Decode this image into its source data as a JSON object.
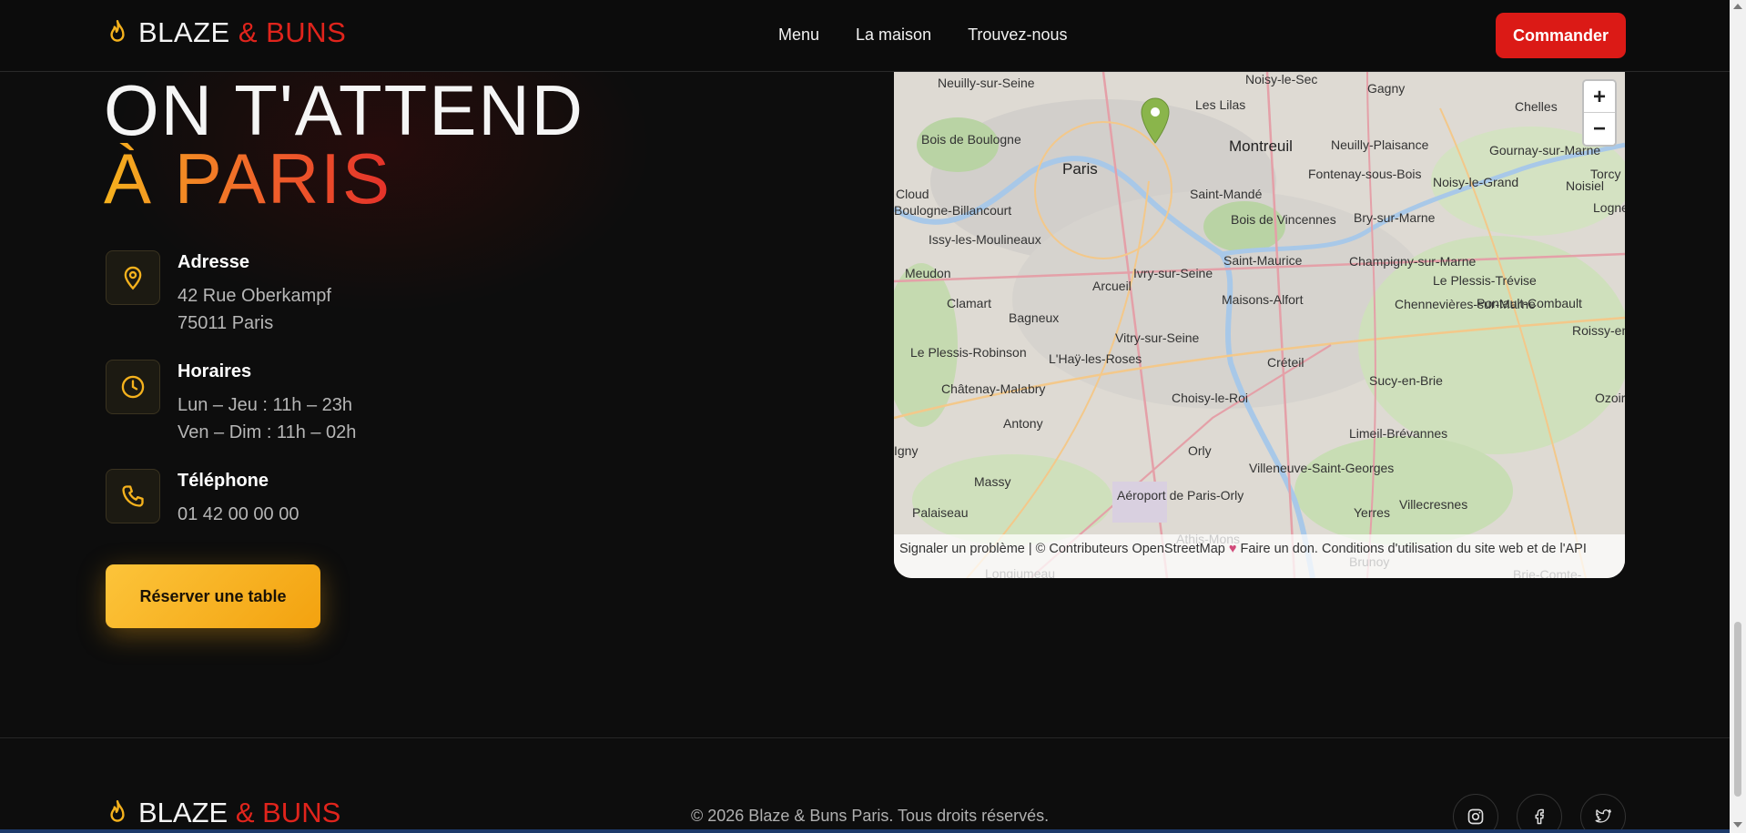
{
  "brand": {
    "word1": "BLAZE",
    "word2": "& BUNS"
  },
  "nav": {
    "items": [
      "Menu",
      "La maison",
      "Trouvez-nous"
    ],
    "order_label": "Commander"
  },
  "hero": {
    "line1": "ON T'ATTEND",
    "line2": "À PARIS"
  },
  "info": {
    "address": {
      "label": "Adresse",
      "lines": [
        "42 Rue Oberkampf",
        "75011 Paris"
      ]
    },
    "hours": {
      "label": "Horaires",
      "lines": [
        "Lun – Jeu : 11h – 23h",
        "Ven – Dim : 11h – 02h"
      ]
    },
    "phone": {
      "label": "Téléphone",
      "lines": [
        "01 42 00 00 00"
      ]
    }
  },
  "reserve_label": "Réserver une table",
  "map": {
    "zoom_in": "+",
    "zoom_out": "−",
    "attribution": {
      "report": "Signaler un problème",
      "sep": " | © ",
      "contributors": "Contributeurs OpenStreetMap",
      "donate": "Faire un don.",
      "terms": "Conditions d'utilisation du site web et de l'API"
    },
    "places": [
      "Neuilly-sur-Seine",
      "Noisy-le-Sec",
      "Gagny",
      "Chelles",
      "Les Lilas",
      "Montreuil",
      "Neuilly-Plaisance",
      "Gournay-sur-Marne",
      "Bois de Boulogne",
      "Paris",
      "Fontenay-sous-Bois",
      "Noisy-le-Grand",
      "Noisiel",
      "Torcy",
      "Lognes",
      "Saint-Mandé",
      "Bois de Vincennes",
      "Cloud",
      "Boulogne-Billancourt",
      "Bry-sur-Marne",
      "Issy-les-Moulineaux",
      "Saint-Maurice",
      "Champigny-sur-Marne",
      "Meudon",
      "Ivry-sur-Seine",
      "Le Plessis-Trévise",
      "Arcueil",
      "Clamart",
      "Maisons-Alfort",
      "Chennevières-sur-Marne",
      "Pontault-Combault",
      "Bagneux",
      "Vitry-sur-Seine",
      "Roissy-en-",
      "Le Plessis-Robinson",
      "L'Haÿ-les-Roses",
      "Créteil",
      "Châtenay-Malabry",
      "Choisy-le-Roi",
      "Sucy-en-Brie",
      "Antony",
      "Limeil-Brévannes",
      "Ozoir",
      "Igny",
      "Orly",
      "Massy",
      "Villeneuve-Saint-Georges",
      "Aéroport de Paris-Orly",
      "Villecresnes",
      "Palaiseau",
      "Yerres",
      "Athis-Mons",
      "Longjumeau",
      "Brunoy",
      "Brie-Comte-"
    ]
  },
  "footer": {
    "copyright": "© 2026 Blaze & Buns Paris. Tous droits réservés."
  },
  "social": [
    "instagram-icon",
    "facebook-icon",
    "twitter-icon"
  ],
  "colors": {
    "accent_red": "#db1a16",
    "accent_orange": "#f5b21d",
    "background": "#0d0d0d"
  }
}
